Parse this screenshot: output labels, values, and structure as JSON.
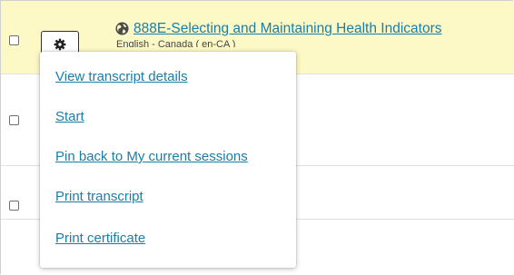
{
  "course": {
    "title": "888E-Selecting and Maintaining Health Indicators",
    "language": "English - Canada ( en-CA )"
  },
  "actions_menu": {
    "items": [
      {
        "label": "View transcript details"
      },
      {
        "label": "Start"
      },
      {
        "label": "Pin back to My current sessions"
      },
      {
        "label": "Print transcript"
      },
      {
        "label": "Print certificate"
      }
    ]
  },
  "colors": {
    "highlight_row": "#fdf9c6",
    "link": "#1a7ea6"
  },
  "icons": {
    "actions_button": "gear-icon",
    "course_type": "globe-icon"
  }
}
